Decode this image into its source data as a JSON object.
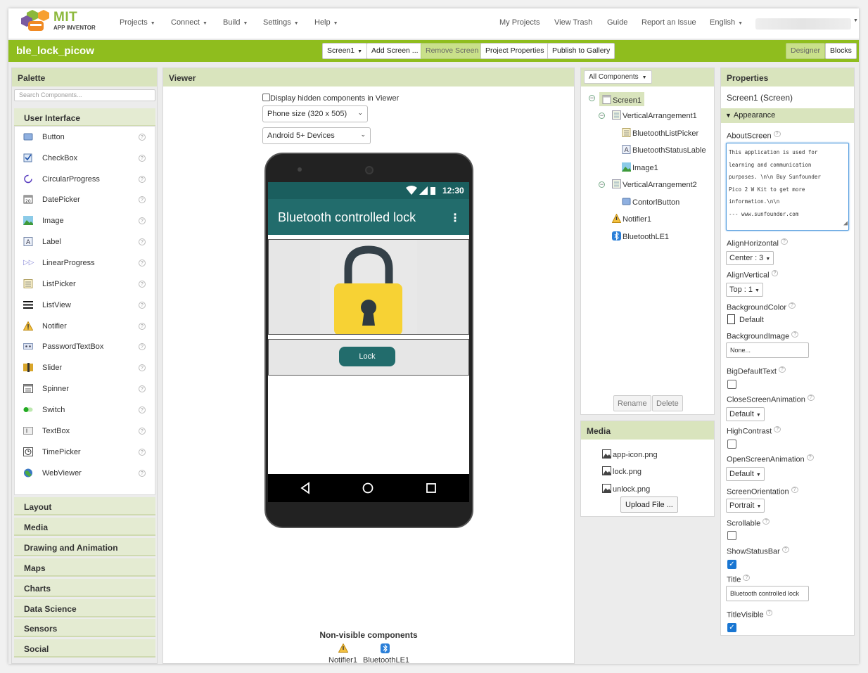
{
  "topnav": {
    "logo_mit": "MIT",
    "logo_app_inventor": "APP INVENTOR",
    "menus": [
      "Projects",
      "Connect",
      "Build",
      "Settings",
      "Help"
    ],
    "links": [
      "My Projects",
      "View Trash",
      "Guide",
      "Report an Issue"
    ],
    "language": "English"
  },
  "toolbar": {
    "project_name": "ble_lock_picow",
    "screen_select": "Screen1",
    "add_screen": "Add Screen ...",
    "remove_screen": "Remove Screen",
    "project_properties": "Project Properties",
    "publish": "Publish to Gallery",
    "designer": "Designer",
    "blocks": "Blocks"
  },
  "palette": {
    "title": "Palette",
    "search_placeholder": "Search Components...",
    "open_category": "User Interface",
    "items": [
      {
        "label": "Button",
        "icon": "button-icon"
      },
      {
        "label": "CheckBox",
        "icon": "checkbox-icon"
      },
      {
        "label": "CircularProgress",
        "icon": "circular-progress-icon"
      },
      {
        "label": "DatePicker",
        "icon": "datepicker-icon"
      },
      {
        "label": "Image",
        "icon": "image-icon"
      },
      {
        "label": "Label",
        "icon": "label-icon"
      },
      {
        "label": "LinearProgress",
        "icon": "linear-progress-icon"
      },
      {
        "label": "ListPicker",
        "icon": "listpicker-icon"
      },
      {
        "label": "ListView",
        "icon": "listview-icon"
      },
      {
        "label": "Notifier",
        "icon": "notifier-icon"
      },
      {
        "label": "PasswordTextBox",
        "icon": "password-icon"
      },
      {
        "label": "Slider",
        "icon": "slider-icon"
      },
      {
        "label": "Spinner",
        "icon": "spinner-icon"
      },
      {
        "label": "Switch",
        "icon": "switch-icon"
      },
      {
        "label": "TextBox",
        "icon": "textbox-icon"
      },
      {
        "label": "TimePicker",
        "icon": "timepicker-icon"
      },
      {
        "label": "WebViewer",
        "icon": "webviewer-icon"
      }
    ],
    "categories": [
      "Layout",
      "Media",
      "Drawing and Animation",
      "Maps",
      "Charts",
      "Data Science",
      "Sensors",
      "Social"
    ]
  },
  "viewer": {
    "title": "Viewer",
    "hidden_components_label": "Display hidden components in Viewer",
    "phone_size": "Phone size (320 x 505)",
    "android_version": "Android 5+ Devices",
    "status_time": "12:30",
    "app_title": "Bluetooth controlled lock",
    "lock_button": "Lock",
    "nonvisible_title": "Non-visible components",
    "nonvisible": [
      "Notifier1",
      "BluetoothLE1"
    ]
  },
  "components": {
    "filter": "All Components",
    "tree": [
      {
        "label": "Screen1",
        "icon": "screen-icon"
      },
      {
        "label": "VerticalArrangement1",
        "icon": "arrangement-icon"
      },
      {
        "label": "BluetoothListPicker",
        "icon": "listpicker-icon"
      },
      {
        "label": "BluetoothStatusLable",
        "icon": "label-icon"
      },
      {
        "label": "Image1",
        "icon": "image-icon"
      },
      {
        "label": "VerticalArrangement2",
        "icon": "arrangement-icon"
      },
      {
        "label": "ContorlButton",
        "icon": "button-icon"
      },
      {
        "label": "Notifier1",
        "icon": "notifier-icon"
      },
      {
        "label": "BluetoothLE1",
        "icon": "bluetooth-icon"
      }
    ],
    "rename": "Rename",
    "delete": "Delete"
  },
  "media": {
    "title": "Media",
    "files": [
      "app-icon.png",
      "lock.png",
      "unlock.png"
    ],
    "upload": "Upload File ..."
  },
  "properties": {
    "title": "Properties",
    "subtitle": "Screen1 (Screen)",
    "section": "Appearance",
    "about_label": "AboutScreen",
    "about_lines": [
      "This application is used for",
      "learning and communication",
      "purposes. \\n\\n Buy Sunfounder",
      "Pico 2 W Kit to get more",
      "information.\\n\\n",
      "--- www.sunfounder.com"
    ],
    "align_h_label": "AlignHorizontal",
    "align_h_value": "Center : 3",
    "align_v_label": "AlignVertical",
    "align_v_value": "Top : 1",
    "bgcolor_label": "BackgroundColor",
    "bgcolor_value": "Default",
    "bgimage_label": "BackgroundImage",
    "bgimage_value": "None...",
    "bigtext_label": "BigDefaultText",
    "close_anim_label": "CloseScreenAnimation",
    "close_anim_value": "Default",
    "contrast_label": "HighContrast",
    "open_anim_label": "OpenScreenAnimation",
    "open_anim_value": "Default",
    "orientation_label": "ScreenOrientation",
    "orientation_value": "Portrait",
    "scrollable_label": "Scrollable",
    "statusbar_label": "ShowStatusBar",
    "title_label": "Title",
    "title_value": "Bluetooth controlled lock",
    "title_visible_label": "TitleVisible"
  }
}
